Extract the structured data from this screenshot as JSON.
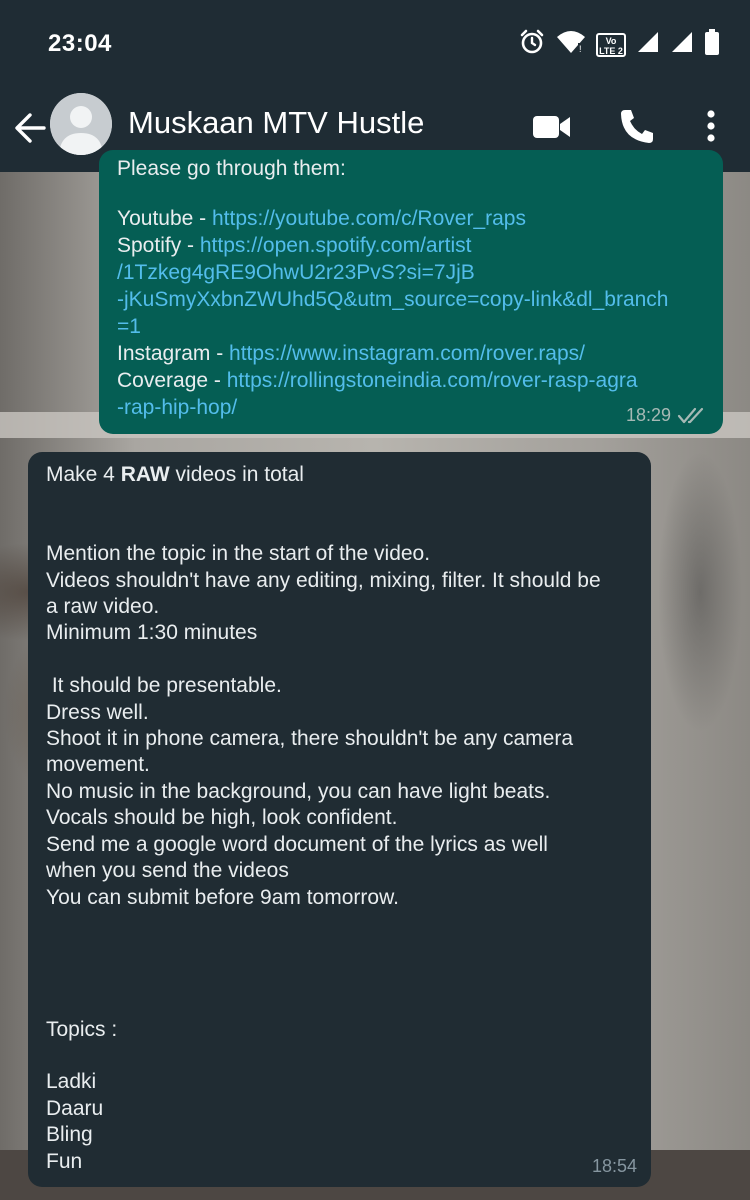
{
  "status_bar": {
    "time": "23:04",
    "lte_badge_top": "Vo",
    "lte_badge_bottom": "LTE 2",
    "icons": [
      "alarm-icon",
      "wifi-icon",
      "volte-icon",
      "signal-icon",
      "signal-icon",
      "battery-icon"
    ]
  },
  "header": {
    "back_icon": "arrow-left-icon",
    "contact_name": "Muskaan MTV Hustle",
    "actions": [
      "video-call-icon",
      "phone-call-icon",
      "more-vert-icon"
    ]
  },
  "outgoing_message": {
    "cut_off_text": "Please go through them:",
    "lines": [
      {
        "label": "Youtube - ",
        "link": "https://youtube.com/c/Rover_raps"
      },
      {
        "label": "Spotify - ",
        "link": "https://open.spotify.com/artist"
      },
      {
        "label": "",
        "link": "/1Tzkeg4gRE9OhwU2r23PvS?si=7JjB"
      },
      {
        "label": "",
        "link": "-jKuSmyXxbnZWUhd5Q&utm_source=copy-link&dl_branch"
      },
      {
        "label": "",
        "link": "=1"
      },
      {
        "label": "Instagram - ",
        "link": "https://www.instagram.com/rover.raps/"
      },
      {
        "label": "Coverage - ",
        "link": "https://rollingstoneindia.com/rover-rasp-agra"
      },
      {
        "label": "",
        "link": "-rap-hip-hop/"
      }
    ],
    "time": "18:29",
    "read_receipt": "double-check-icon"
  },
  "incoming_message": {
    "first_line_prefix": "Make 4 ",
    "first_line_bold": "RAW",
    "first_line_suffix": " videos in total",
    "body": "\n\nMention the topic in the start of the video.\nVideos shouldn't have any editing, mixing, filter. It should be\na raw video.\nMinimum 1:30 minutes\n\n It should be presentable.\nDress well.\nShoot it in phone camera, there shouldn't be any camera\nmovement.\nNo music in the background, you can have light beats.\nVocals should be high, look confident.\nSend me a google word document of the lyrics as well\nwhen you send the videos\nYou can submit before 9am tomorrow.\n\n\n\n\nTopics :\n\nLadki\nDaaru\nBling\nFun",
    "time": "18:54"
  },
  "colors": {
    "app_bar": "#1f2c34",
    "outgoing_bubble": "#055e54",
    "incoming_bubble": "#202c33",
    "link": "#53bdeb",
    "text": "#e9edef",
    "meta": "#8696a0"
  }
}
